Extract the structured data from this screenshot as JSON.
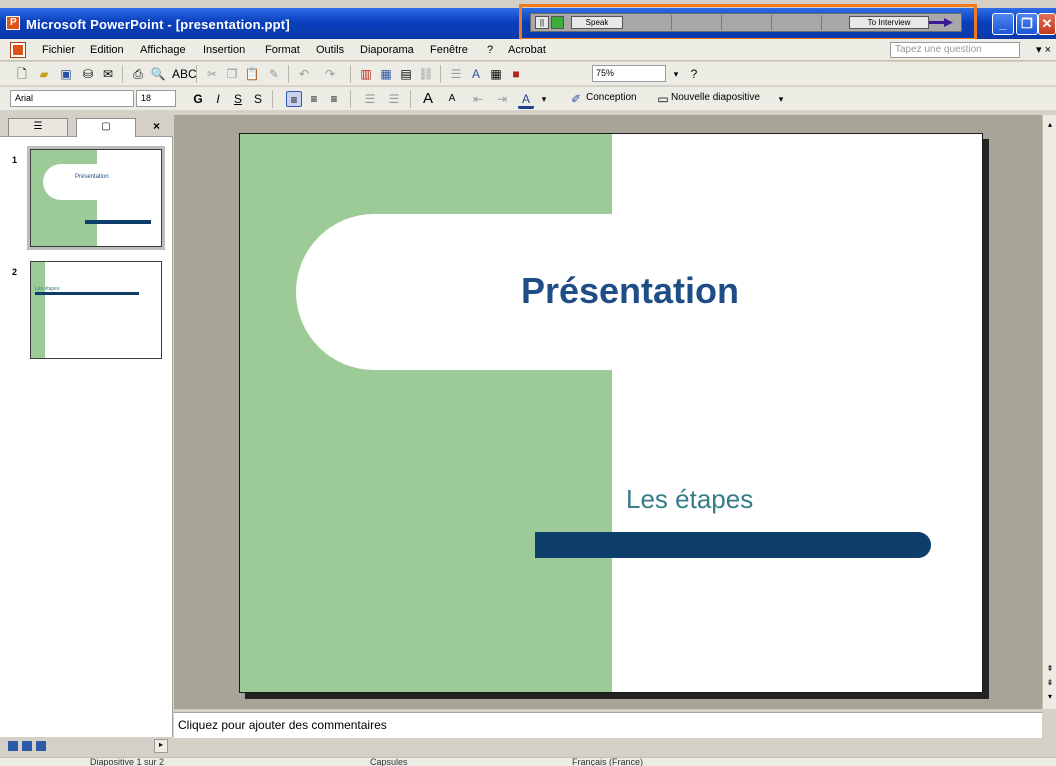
{
  "window": {
    "title": "Microsoft PowerPoint - [presentation.ppt]",
    "minimize_label": "_",
    "restore_label": "❐",
    "close_label": "✕"
  },
  "recorder": {
    "speak_label": "Speak",
    "to_label": "To Interview",
    "accent_color": "#f17a1e"
  },
  "menu": {
    "items": [
      "Fichier",
      "Edition",
      "Affichage",
      "Insertion",
      "Format",
      "Outils",
      "Diaporama",
      "Fenêtre",
      "?",
      "Acrobat"
    ],
    "ask_placeholder": "Tapez une question",
    "close_label": "▾ ×"
  },
  "toolbar_standard": {
    "zoom_value": "75%",
    "help_label": "?"
  },
  "toolbar_format": {
    "font_name": "Arial",
    "font_size": "18",
    "bold": "G",
    "italic": "I",
    "underline": "S",
    "shadow": "S",
    "design_label": "Conception",
    "new_slide_label": "Nouvelle diapositive"
  },
  "left_panel": {
    "tab_outline": "☰",
    "tab_slides": "▢",
    "close_label": "×",
    "thumbnails": [
      {
        "number": "1",
        "title": "Présentation"
      },
      {
        "number": "2",
        "title": "Les étapes"
      }
    ]
  },
  "slide": {
    "title": "Présentation",
    "subtitle": "Les étapes",
    "colors": {
      "green": "#9ccb98",
      "title": "#1f4e86",
      "subtitle": "#367d8a",
      "bar": "#0d3d6b"
    }
  },
  "notes": {
    "placeholder": "Cliquez pour ajouter des commentaires"
  },
  "status": {
    "slide_info": "Diapositive 1 sur 2",
    "design": "Capsules",
    "language": "Français (France)"
  }
}
